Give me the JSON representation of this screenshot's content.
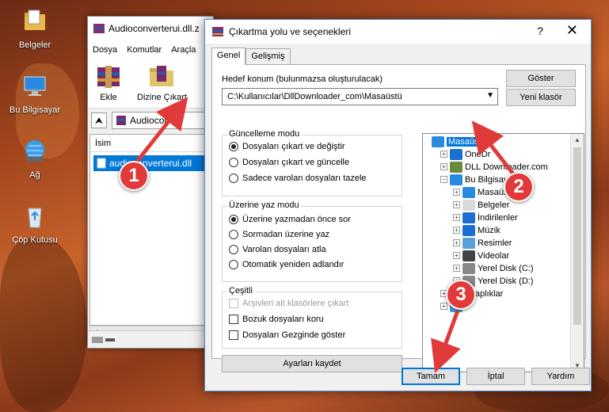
{
  "desktop": {
    "icons": [
      {
        "label": "Belgeler",
        "icon": "documents-folder-icon"
      },
      {
        "label": "Bu Bilgisayar",
        "icon": "computer-icon"
      },
      {
        "label": "Ağ",
        "icon": "network-icon"
      },
      {
        "label": "Çöp Kutusu",
        "icon": "recycle-bin-icon"
      }
    ]
  },
  "winrar": {
    "title": "Audioconverterui.dll.z",
    "menu": [
      "Dosya",
      "Komutlar",
      "Araçla"
    ],
    "toolbar": {
      "add_label": "Ekle",
      "extract_label": "Dizine Çıkart"
    },
    "path_text": "Audioconve",
    "list_header": "İsim",
    "file_name": "audioconverterui.dll"
  },
  "dialog": {
    "title": "Çıkartma yolu ve seçenekleri",
    "help_glyph": "?",
    "close_glyph": "✕",
    "tabs": [
      "Genel",
      "Gelişmiş"
    ],
    "dest_label": "Hedef konum (bulunmazsa oluşturulacak)",
    "dest_value": "C:\\Kullanıcılar\\DllDownloader_com\\Masaüstü",
    "show_button": "Göster",
    "new_folder_button": "Yeni klasör",
    "update_mode": {
      "title": "Güncelleme modu",
      "options": [
        "Dosyaları çıkart ve değiştir",
        "Dosyaları çıkart ve güncelle",
        "Sadece varolan dosyaları tazele"
      ],
      "selected": 0
    },
    "overwrite_mode": {
      "title": "Üzerine yaz modu",
      "options": [
        "Üzerine yazmadan önce sor",
        "Sormadan üzerine yaz",
        "Varolan dosyaları atla",
        "Otomatik yeniden adlandır"
      ],
      "selected": 0
    },
    "misc": {
      "title": "Çeşitli",
      "options": [
        "Arşivleri alt klasörlere çıkart",
        "Bozuk dosyaları koru",
        "Dosyaları Gezginde göster"
      ]
    },
    "save_settings_button": "Ayarları kaydet",
    "tree": [
      {
        "label": "Masaüstü",
        "level": 0,
        "expander": "",
        "selected": true,
        "icon": "desktop-icon"
      },
      {
        "label": "OneDr",
        "level": 1,
        "expander": "+",
        "icon": "onedrive-icon"
      },
      {
        "label": "DLL Downloader.com",
        "level": 1,
        "expander": "+",
        "icon": "user-icon"
      },
      {
        "label": "Bu Bilgisayar",
        "level": 1,
        "expander": "−",
        "icon": "computer-icon"
      },
      {
        "label": "Masaüstü",
        "level": 2,
        "expander": "+",
        "icon": "desktop-icon"
      },
      {
        "label": "Belgeler",
        "level": 2,
        "expander": "+",
        "icon": "documents-icon"
      },
      {
        "label": "İndirilenler",
        "level": 2,
        "expander": "+",
        "icon": "downloads-icon"
      },
      {
        "label": "Müzik",
        "level": 2,
        "expander": "+",
        "icon": "music-icon"
      },
      {
        "label": "Resimler",
        "level": 2,
        "expander": "+",
        "icon": "pictures-icon"
      },
      {
        "label": "Videolar",
        "level": 2,
        "expander": "+",
        "icon": "videos-icon"
      },
      {
        "label": "Yerel Disk (C:)",
        "level": 2,
        "expander": "+",
        "icon": "drive-icon"
      },
      {
        "label": "Yerel Disk (D:)",
        "level": 2,
        "expander": "+",
        "icon": "drive-icon"
      },
      {
        "label": "Kitaplıklar",
        "level": 1,
        "expander": "+",
        "icon": "libraries-icon"
      },
      {
        "label": "",
        "level": 1,
        "expander": "+",
        "icon": "network-icon"
      }
    ],
    "ok_button": "Tamam",
    "cancel_button": "İptal",
    "help_button": "Yardım"
  },
  "callouts": [
    "1",
    "2",
    "3"
  ],
  "colors": {
    "selection": "#0078d7",
    "callout": "#e03a3a"
  }
}
